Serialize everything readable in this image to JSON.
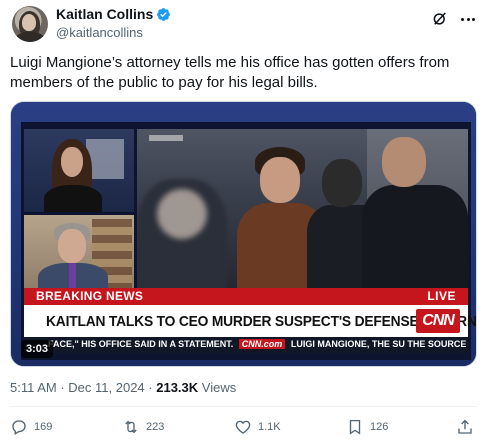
{
  "author": {
    "display_name": "Kaitlan Collins",
    "handle": "@kaitlancollins"
  },
  "tweet": {
    "text": "Luigi Mangione’s attorney tells me his office has gotten offers from members of the public to pay for his legal bills."
  },
  "media": {
    "breaking_label": "BREAKING NEWS",
    "live_label": "LIVE",
    "headline": "KAITLAN TALKS TO CEO MURDER SUSPECT'S DEFENSE ATTORNEY",
    "logo": "CNN",
    "ticker_left": "FACE,\" HIS OFFICE SAID IN A STATEMENT.",
    "ticker_logo": "CNN.com",
    "ticker_right": "LUIGI MANGIONE, THE SU",
    "ticker_end": "THE SOURCE",
    "duration": "3:03"
  },
  "meta": {
    "time": "5:11 AM",
    "separator": " · ",
    "date": "Dec 11, 2024",
    "views_count": "213.3K",
    "views_label": "Views"
  },
  "actions": {
    "replies": "169",
    "reposts": "223",
    "likes": "1.1K",
    "bookmarks": "126"
  },
  "colors": {
    "verified": "#1d9bf0",
    "breaking_red": "#c4161c",
    "secondary_text": "#536471"
  },
  "icons": [
    "verified-icon",
    "grok-icon",
    "more-icon",
    "reply-icon",
    "repost-icon",
    "like-icon",
    "bookmark-icon",
    "share-icon"
  ]
}
